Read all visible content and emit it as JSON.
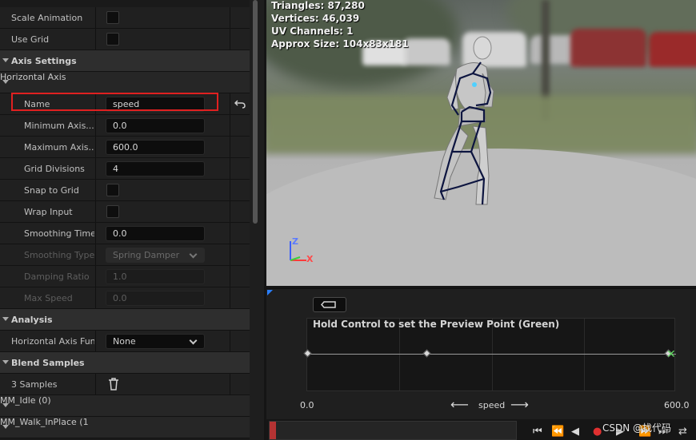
{
  "details": {
    "rows": [
      {
        "kind": "prop",
        "label": "Scale Animation",
        "level": 0,
        "control": "checkbox",
        "value": ""
      },
      {
        "kind": "prop",
        "label": "Use Grid",
        "level": 0,
        "control": "checkbox",
        "value": ""
      },
      {
        "kind": "category",
        "label": "Axis Settings"
      },
      {
        "kind": "subcategory",
        "label": "Horizontal Axis"
      },
      {
        "kind": "prop",
        "label": "Name",
        "level": 1,
        "control": "text",
        "value": "speed",
        "reset": true
      },
      {
        "kind": "prop",
        "label": "Minimum Axis...",
        "level": 1,
        "control": "text",
        "value": "0.0"
      },
      {
        "kind": "prop",
        "label": "Maximum Axis...",
        "level": 1,
        "control": "text",
        "value": "600.0"
      },
      {
        "kind": "prop",
        "label": "Grid Divisions",
        "level": 1,
        "control": "text",
        "value": "4"
      },
      {
        "kind": "prop",
        "label": "Snap to Grid",
        "level": 1,
        "control": "checkbox",
        "value": ""
      },
      {
        "kind": "prop",
        "label": "Wrap Input",
        "level": 1,
        "control": "checkbox",
        "value": ""
      },
      {
        "kind": "prop",
        "label": "Smoothing Time",
        "level": 1,
        "control": "text",
        "value": "0.0"
      },
      {
        "kind": "prop",
        "label": "Smoothing Type",
        "level": 1,
        "control": "dropdown",
        "value": "Spring Damper",
        "disabled": true
      },
      {
        "kind": "prop",
        "label": "Damping Ratio",
        "level": 1,
        "control": "text",
        "value": "1.0",
        "disabled": true
      },
      {
        "kind": "prop",
        "label": "Max Speed",
        "level": 1,
        "control": "text",
        "value": "0.0",
        "disabled": true
      },
      {
        "kind": "category",
        "label": "Analysis"
      },
      {
        "kind": "prop",
        "label": "Horizontal Axis Func",
        "level": 0,
        "control": "dropdown",
        "value": "None"
      },
      {
        "kind": "category",
        "label": "Blend Samples"
      },
      {
        "kind": "prop",
        "label": "3 Samples",
        "level": 0,
        "control": "trash",
        "value": ""
      },
      {
        "kind": "subcategory",
        "label": "MM_Idle (0)"
      },
      {
        "kind": "subcategory",
        "label": "MM_Walk_InPlace (1"
      }
    ]
  },
  "viewport": {
    "stats": [
      "Triangles: 87,280",
      "Vertices: 46,039",
      "UV Channels: 1",
      "Approx Size: 104x83x181"
    ],
    "gizmo_z": "Z",
    "gizmo_x": "X"
  },
  "blend": {
    "hint": "Hold Control to set the Preview Point (Green)",
    "axis_min": "0.0",
    "axis_max": "600.0",
    "axis_name": "speed",
    "arrow_left": "⟵",
    "arrow_right": "⟶",
    "samples": [
      0.0,
      0.33,
      1.0
    ],
    "preview_value": 1.0,
    "preview_glyph": "✕",
    "grid_divisions": 4
  },
  "timeline": {
    "watermark": "CSDN @找代码",
    "controls": [
      "⏮",
      "⏪",
      "◀",
      "●",
      "▶",
      "⏩",
      "⏭",
      "⇄"
    ]
  },
  "colors": {
    "highlight": "#e02020",
    "preview": "#5fd35f",
    "accent": "#2a7fff"
  }
}
